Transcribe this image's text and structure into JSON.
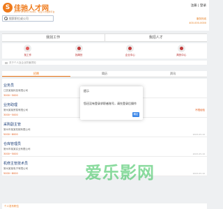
{
  "site": {
    "logo_mark": "S",
    "logo_text": "佳驰人才网",
    "tagline": "JIACHI RENCAI WANG · 专业人才招聘平台",
    "auth_login": "注册",
    "auth_sep": "|",
    "auth_register": "登录",
    "hotline": "服务热线",
    "hotline_number": "400-000-0000"
  },
  "search": {
    "placeholder": "搜索职位或公司"
  },
  "role_tabs": [
    "我找工作",
    "我招人才"
  ],
  "quick": [
    {
      "label": "找工作",
      "color": "#e25a5a"
    },
    {
      "label": "找简历",
      "color": "#c23a3a"
    },
    {
      "label": "企业中心",
      "color": "#c23a3a"
    },
    {
      "label": "简历中心",
      "color": "#c23a3a"
    }
  ],
  "notice": "关于个人及企业防骗须知",
  "list_tabs": [
    "招聘",
    "简历",
    "资讯"
  ],
  "jobs": [
    {
      "title": "业务员",
      "company": "江苏某某科技有限公司",
      "salary": "3000~5000",
      "right": "",
      "date": ""
    },
    {
      "title": "业务助理",
      "company": "常州某某贸易有限公司",
      "salary": "3000~5000",
      "right": "不限经验",
      "date": ""
    },
    {
      "title": "采购副主管",
      "company": "常州市某某机械有限公司",
      "salary": "5000~8000",
      "right": "",
      "date": "2023-05-10"
    },
    {
      "title": "仓库管理员",
      "company": "常州市某某实业有限公司",
      "salary": "3000~5000",
      "right": "",
      "date": "2023-05-10"
    },
    {
      "title": "机修主管技术员",
      "company": "常州某某电子有限公司",
      "salary": "5000~8000",
      "right": "",
      "date": "2023-05-10"
    }
  ],
  "footer": "个人发布职位",
  "watermark": "爱乐影网",
  "dialog": {
    "title": "提示",
    "message": "您还没有登录求职者账号，请先登录后操作",
    "ok": "确定"
  }
}
